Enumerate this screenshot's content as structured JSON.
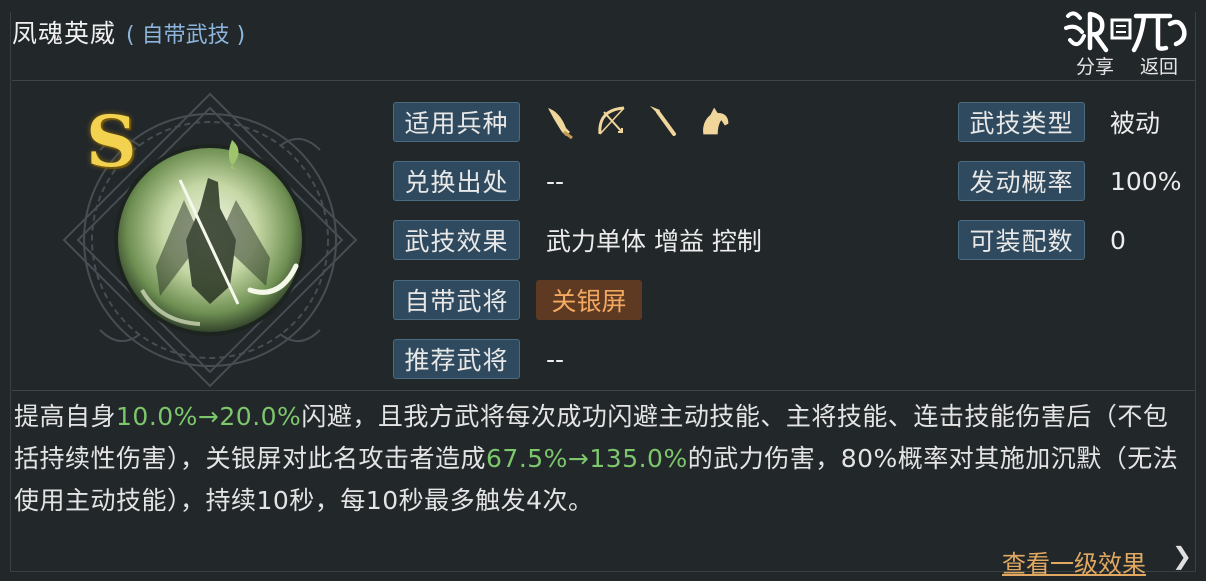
{
  "header": {
    "title": "凤魂英威",
    "subtitle": "( 自带武技 )",
    "share_label": "分享",
    "back_label": "返回"
  },
  "skill": {
    "rank": "S",
    "attributes_left": [
      {
        "label": "适用兵种",
        "value": ""
      },
      {
        "label": "兑换出处",
        "value": "--"
      },
      {
        "label": "武技效果",
        "value": "武力单体 增益 控制"
      },
      {
        "label": "自带武将",
        "value": "关银屏"
      },
      {
        "label": "推荐武将",
        "value": "--"
      }
    ],
    "attributes_right": [
      {
        "label": "武技类型",
        "value": "被动"
      },
      {
        "label": "发动概率",
        "value": "100%"
      },
      {
        "label": "可装配数",
        "value": "0"
      }
    ],
    "troop_icons": [
      "saber-icon",
      "bow-icon",
      "spear-icon",
      "horse-icon"
    ]
  },
  "description": {
    "p1": "提高自身",
    "v1": "10.0%→20.0%",
    "p2": "闪避，且我方武将每次成功闪避主动技能、主将技能、连击技能伤害后（不包括持续性伤害），关银屏对此名攻击者造成",
    "v2": "67.5%→135.0%",
    "p3": "的武力伤害，80%概率对其施加沉默（无法使用主动技能），持续10秒，每10秒最多触发4次。"
  },
  "footer": {
    "more_label": "查看一级效果",
    "more_arrow": "❯"
  },
  "colors": {
    "background": "#22272a",
    "label_bg": "#2f4a5e",
    "highlight": "#7cc66c",
    "accent": "#e0a860",
    "rank_gold": "#f2d24e"
  }
}
